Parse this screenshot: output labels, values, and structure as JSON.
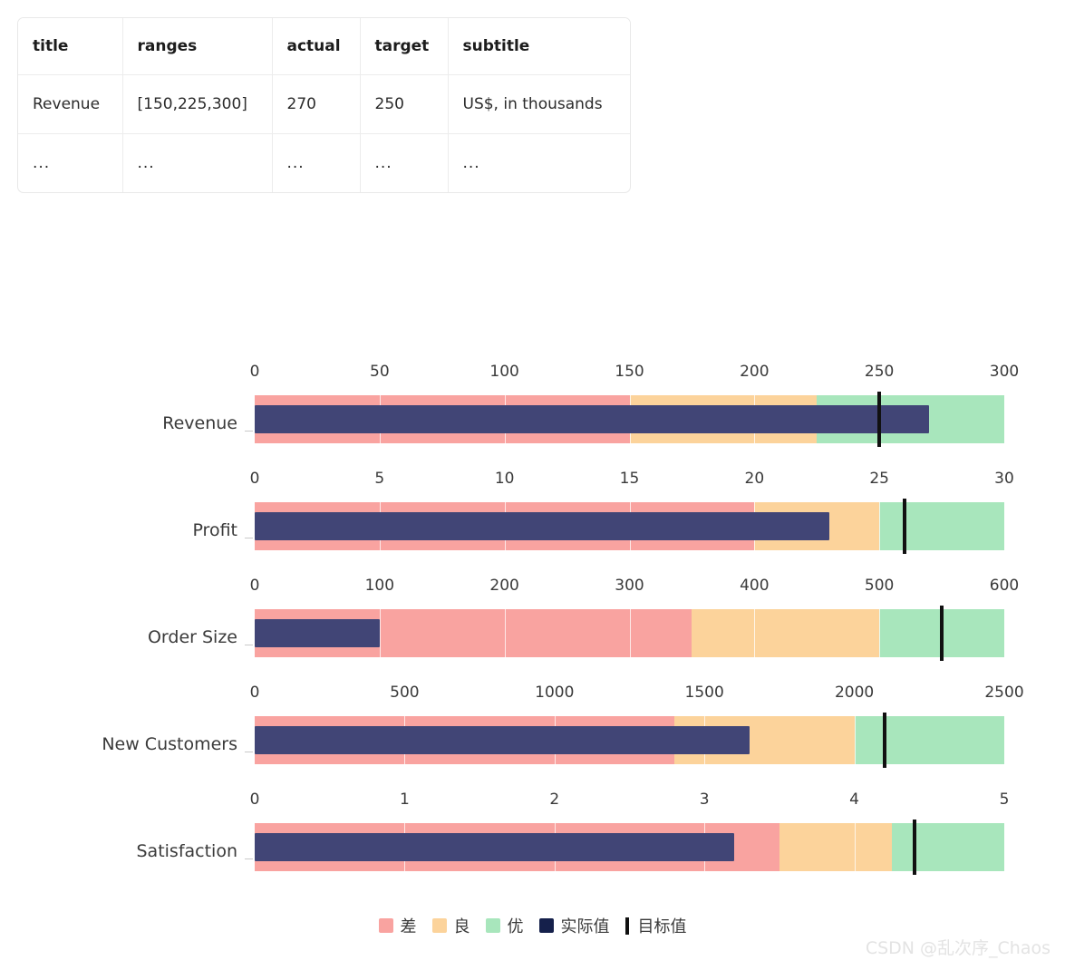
{
  "table": {
    "headers": [
      "title",
      "ranges",
      "actual",
      "target",
      "subtitle"
    ],
    "rows": [
      {
        "title": "Revenue",
        "ranges": "[150,225,300]",
        "actual": "270",
        "target": "250",
        "subtitle": "US$, in thousands"
      },
      {
        "title": "...",
        "ranges": "...",
        "actual": "...",
        "target": "...",
        "subtitle": "..."
      }
    ]
  },
  "legend": {
    "items": [
      {
        "label": "差",
        "type": "swatch",
        "color": "#F9A3A0",
        "name": "legend-poor"
      },
      {
        "label": "良",
        "type": "swatch",
        "color": "#FCD39B",
        "name": "legend-fair"
      },
      {
        "label": "优",
        "type": "swatch",
        "color": "#A8E6BC",
        "name": "legend-good"
      },
      {
        "label": "实际值",
        "type": "swatch",
        "color": "#15204B",
        "name": "legend-actual"
      },
      {
        "label": "目标值",
        "type": "line",
        "color": "#111111",
        "name": "legend-target"
      }
    ]
  },
  "watermark": {
    "text": "CSDN @乱次序_Chaos"
  },
  "colors": {
    "poor": "#F9A3A0",
    "fair": "#FCD39B",
    "good": "#A8E6BC",
    "actual": "#414576",
    "target": "#111111"
  },
  "chart_data": {
    "type": "bar",
    "subtype": "bullet",
    "title": "",
    "xlabel": "",
    "ylabel": "",
    "grid": true,
    "legend_position": "bottom",
    "categories": [
      "Revenue",
      "Profit",
      "Order Size",
      "New Customers",
      "Satisfaction"
    ],
    "rows": [
      {
        "title": "Revenue",
        "subtitle": "US$, in thousands",
        "axis_min": 0,
        "axis_max": 300,
        "ticks": [
          0,
          50,
          100,
          150,
          200,
          250,
          300
        ],
        "tick_labels": [
          "0",
          "50",
          "100",
          "150",
          "200",
          "250",
          "300"
        ],
        "ranges": [
          150,
          225,
          300
        ],
        "actual": 270,
        "target": 250
      },
      {
        "title": "Profit",
        "subtitle": "",
        "axis_min": 0,
        "axis_max": 30,
        "ticks": [
          0,
          5,
          10,
          15,
          20,
          25,
          30
        ],
        "tick_labels": [
          "0",
          "5",
          "10",
          "15",
          "20",
          "25",
          "30"
        ],
        "ranges": [
          20,
          25,
          30
        ],
        "actual": 23,
        "target": 26
      },
      {
        "title": "Order Size",
        "subtitle": "",
        "axis_min": 0,
        "axis_max": 600,
        "ticks": [
          0,
          100,
          200,
          300,
          400,
          500,
          600
        ],
        "tick_labels": [
          "0",
          "100",
          "200",
          "300",
          "400",
          "500",
          "600"
        ],
        "ranges": [
          350,
          500,
          600
        ],
        "actual": 100,
        "target": 550
      },
      {
        "title": "New Customers",
        "subtitle": "",
        "axis_min": 0,
        "axis_max": 2500,
        "ticks": [
          0,
          500,
          1000,
          1500,
          2000,
          2500
        ],
        "tick_labels": [
          "0",
          "500",
          "1000",
          "1500",
          "2000",
          "2500"
        ],
        "ranges": [
          1400,
          2000,
          2500
        ],
        "actual": 1650,
        "target": 2100
      },
      {
        "title": "Satisfaction",
        "subtitle": "",
        "axis_min": 0,
        "axis_max": 5,
        "ticks": [
          0,
          1,
          2,
          3,
          4,
          5
        ],
        "tick_labels": [
          "0",
          "1",
          "2",
          "3",
          "4",
          "5"
        ],
        "ranges": [
          3.5,
          4.25,
          5
        ],
        "actual": 3.2,
        "target": 4.4
      }
    ]
  }
}
